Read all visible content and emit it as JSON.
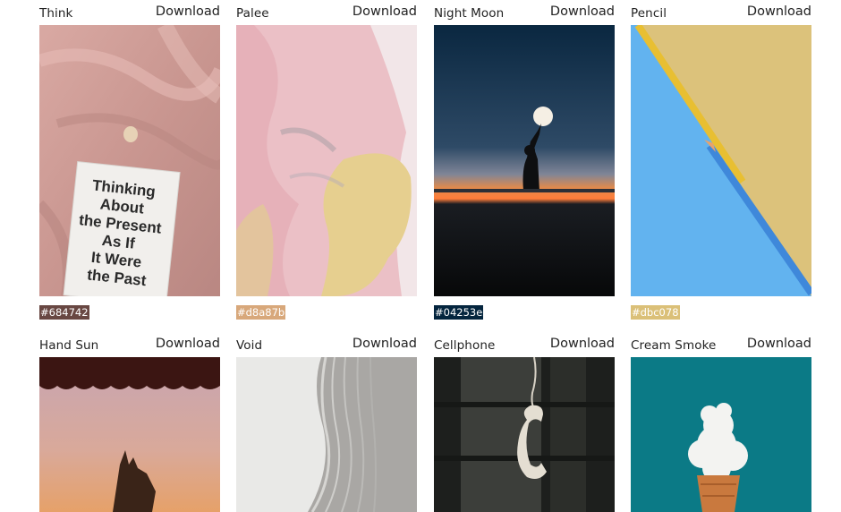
{
  "cards": [
    {
      "title": "Think",
      "download": "Download",
      "hex": "#684742",
      "color": "#684742",
      "image": "book-on-pink-fabric",
      "book_lines": [
        "Thinking",
        "About",
        "the Present",
        "As If",
        "It Were",
        "the Past"
      ]
    },
    {
      "title": "Palee",
      "download": "Download",
      "hex": "#d8a87b",
      "color": "#d8a87b",
      "image": "pink-and-yellow-paint"
    },
    {
      "title": "Night Moon",
      "download": "Download",
      "hex": "#04253e",
      "color": "#04253e",
      "image": "silhouette-holding-moon"
    },
    {
      "title": "Pencil",
      "download": "Download",
      "hex": "#dbc078",
      "color": "#dbc078",
      "image": "pencils-on-blue-and-yellow"
    },
    {
      "title": "Hand Sun",
      "download": "Download",
      "image": "hand-holding-sun"
    },
    {
      "title": "Void",
      "download": "Download",
      "image": "white-curved-architecture"
    },
    {
      "title": "Cellphone",
      "download": "Download",
      "image": "hanging-telephone-handset"
    },
    {
      "title": "Cream Smoke",
      "download": "Download",
      "image": "cloud-in-ice-cream-cone"
    }
  ]
}
